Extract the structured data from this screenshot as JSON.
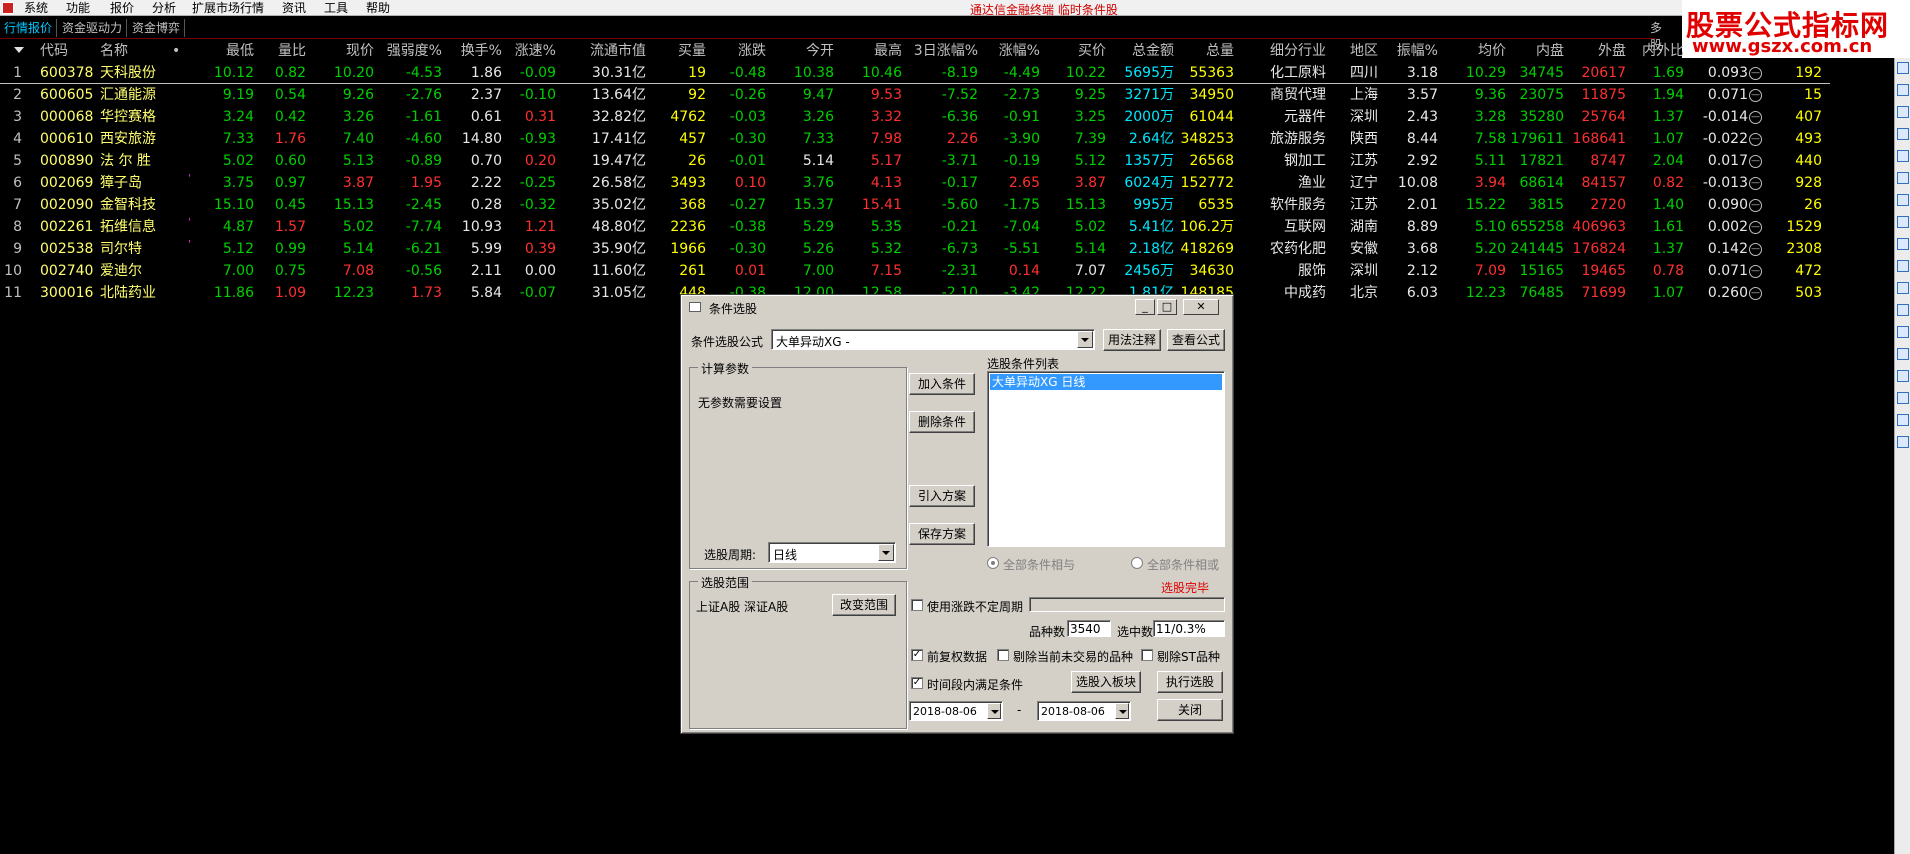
{
  "menu": {
    "items": [
      "系统",
      "功能",
      "报价",
      "分析",
      "扩展市场行情",
      "资讯",
      "工具",
      "帮助"
    ],
    "title": "通达信金融终端 临时条件股"
  },
  "tabs": [
    "行情报价",
    "资金驱动力",
    "资金博弈"
  ],
  "tabs_more": "多股",
  "watermark": {
    "line1": "股票公式指标网",
    "line2": "www.gszx.com.cn"
  },
  "table": {
    "headers": [
      "代码",
      "名称",
      "•",
      "最低",
      "量比",
      "现价",
      "强弱度%",
      "换手%",
      "涨速%",
      "流通市值",
      "买量",
      "涨跌",
      "今开",
      "最高",
      "3日涨幅%",
      "涨幅%",
      "买价",
      "总金额",
      "总量",
      "细分行业",
      "地区",
      "振幅%",
      "均价",
      "内盘",
      "外盘",
      "内外比"
    ],
    "rows": [
      {
        "no": "1",
        "code": "600378",
        "name": "天科股份",
        "flag": "",
        "low": "10.12",
        "vr": "0.82",
        "price": "10.20",
        "str": "-4.53",
        "turn": "1.86",
        "spd": "-0.09",
        "mcap": "30.31亿",
        "bq": "19",
        "chg": "-0.48",
        "open": "10.38",
        "high": "10.46",
        "r3": "-8.19",
        "pct": "-4.49",
        "bp": "10.22",
        "amt": "5695万",
        "vol": "55363",
        "ind": "化工原料",
        "area": "四川",
        "amp": "3.18",
        "avg": "10.29",
        "inv": "34745",
        "outv": "20617",
        "ratio": "1.69",
        "x1": "0.093",
        "x2": "192"
      },
      {
        "no": "2",
        "code": "600605",
        "name": "汇通能源",
        "flag": "",
        "low": "9.19",
        "vr": "0.54",
        "price": "9.26",
        "str": "-2.76",
        "turn": "2.37",
        "spd": "-0.10",
        "mcap": "13.64亿",
        "bq": "92",
        "chg": "-0.26",
        "open": "9.47",
        "high": "9.53",
        "r3": "-7.52",
        "pct": "-2.73",
        "bp": "9.25",
        "amt": "3271万",
        "vol": "34950",
        "ind": "商贸代理",
        "area": "上海",
        "amp": "3.57",
        "avg": "9.36",
        "inv": "23075",
        "outv": "11875",
        "ratio": "1.94",
        "x1": "0.071",
        "x2": "15"
      },
      {
        "no": "3",
        "code": "000068",
        "name": "华控赛格",
        "flag": "",
        "low": "3.24",
        "vr": "0.42",
        "price": "3.26",
        "str": "-1.61",
        "turn": "0.61",
        "spd": "0.31",
        "mcap": "32.82亿",
        "bq": "4762",
        "chg": "-0.03",
        "open": "3.26",
        "high": "3.32",
        "r3": "-6.36",
        "pct": "-0.91",
        "bp": "3.25",
        "amt": "2000万",
        "vol": "61044",
        "ind": "元器件",
        "area": "深圳",
        "amp": "2.43",
        "avg": "3.28",
        "inv": "35280",
        "outv": "25764",
        "ratio": "1.37",
        "x1": "-0.014",
        "x2": "407"
      },
      {
        "no": "4",
        "code": "000610",
        "name": "西安旅游",
        "flag": "",
        "low": "7.33",
        "vr": "1.76",
        "price": "7.40",
        "str": "-4.60",
        "turn": "14.80",
        "spd": "-0.93",
        "mcap": "17.41亿",
        "bq": "457",
        "chg": "-0.30",
        "open": "7.33",
        "high": "7.98",
        "r3": "2.26",
        "pct": "-3.90",
        "bp": "7.39",
        "amt": "2.64亿",
        "vol": "348253",
        "ind": "旅游服务",
        "area": "陕西",
        "amp": "8.44",
        "avg": "7.58",
        "inv": "179611",
        "outv": "168641",
        "ratio": "1.07",
        "x1": "-0.022",
        "x2": "493"
      },
      {
        "no": "5",
        "code": "000890",
        "name": "法 尔 胜",
        "flag": "",
        "low": "5.02",
        "vr": "0.60",
        "price": "5.13",
        "str": "-0.89",
        "turn": "0.70",
        "spd": "0.20",
        "mcap": "19.47亿",
        "bq": "26",
        "chg": "-0.01",
        "open": "5.14",
        "high": "5.17",
        "r3": "-3.71",
        "pct": "-0.19",
        "bp": "5.12",
        "amt": "1357万",
        "vol": "26568",
        "ind": "钢加工",
        "area": "江苏",
        "amp": "2.92",
        "avg": "5.11",
        "inv": "17821",
        "outv": "8747",
        "ratio": "2.04",
        "x1": "0.017",
        "x2": "440"
      },
      {
        "no": "6",
        "code": "002069",
        "name": "獐子岛",
        "flag": "'",
        "low": "3.75",
        "vr": "0.97",
        "price": "3.87",
        "str": "1.95",
        "turn": "2.22",
        "spd": "-0.25",
        "mcap": "26.58亿",
        "bq": "3493",
        "chg": "0.10",
        "open": "3.76",
        "high": "4.13",
        "r3": "-0.17",
        "pct": "2.65",
        "bp": "3.87",
        "amt": "6024万",
        "vol": "152772",
        "ind": "渔业",
        "area": "辽宁",
        "amp": "10.08",
        "avg": "3.94",
        "inv": "68614",
        "outv": "84157",
        "ratio": "0.82",
        "x1": "-0.013",
        "x2": "928"
      },
      {
        "no": "7",
        "code": "002090",
        "name": "金智科技",
        "flag": "",
        "low": "15.10",
        "vr": "0.45",
        "price": "15.13",
        "str": "-2.45",
        "turn": "0.28",
        "spd": "-0.32",
        "mcap": "35.02亿",
        "bq": "368",
        "chg": "-0.27",
        "open": "15.37",
        "high": "15.41",
        "r3": "-5.60",
        "pct": "-1.75",
        "bp": "15.13",
        "amt": "995万",
        "vol": "6535",
        "ind": "软件服务",
        "area": "江苏",
        "amp": "2.01",
        "avg": "15.22",
        "inv": "3815",
        "outv": "2720",
        "ratio": "1.40",
        "x1": "0.090",
        "x2": "26"
      },
      {
        "no": "8",
        "code": "002261",
        "name": "拓维信息",
        "flag": "'",
        "low": "4.87",
        "vr": "1.57",
        "price": "5.02",
        "str": "-7.74",
        "turn": "10.93",
        "spd": "1.21",
        "mcap": "48.80亿",
        "bq": "2236",
        "chg": "-0.38",
        "open": "5.29",
        "high": "5.35",
        "r3": "-0.21",
        "pct": "-7.04",
        "bp": "5.02",
        "amt": "5.41亿",
        "vol": "106.2万",
        "ind": "互联网",
        "area": "湖南",
        "amp": "8.89",
        "avg": "5.10",
        "inv": "655258",
        "outv": "406963",
        "ratio": "1.61",
        "x1": "0.002",
        "x2": "1529"
      },
      {
        "no": "9",
        "code": "002538",
        "name": "司尔特",
        "flag": "'",
        "low": "5.12",
        "vr": "0.99",
        "price": "5.14",
        "str": "-6.21",
        "turn": "5.99",
        "spd": "0.39",
        "mcap": "35.90亿",
        "bq": "1966",
        "chg": "-0.30",
        "open": "5.26",
        "high": "5.32",
        "r3": "-6.73",
        "pct": "-5.51",
        "bp": "5.14",
        "amt": "2.18亿",
        "vol": "418269",
        "ind": "农药化肥",
        "area": "安徽",
        "amp": "3.68",
        "avg": "5.20",
        "inv": "241445",
        "outv": "176824",
        "ratio": "1.37",
        "x1": "0.142",
        "x2": "2308"
      },
      {
        "no": "10",
        "code": "002740",
        "name": "爱迪尔",
        "flag": "",
        "low": "7.00",
        "vr": "0.75",
        "price": "7.08",
        "str": "-0.56",
        "turn": "2.11",
        "spd": "0.00",
        "mcap": "11.60亿",
        "bq": "261",
        "chg": "0.01",
        "open": "7.00",
        "high": "7.15",
        "r3": "-2.31",
        "pct": "0.14",
        "bp": "7.07",
        "amt": "2456万",
        "vol": "34630",
        "ind": "服饰",
        "area": "深圳",
        "amp": "2.12",
        "avg": "7.09",
        "inv": "15165",
        "outv": "19465",
        "ratio": "0.78",
        "x1": "0.071",
        "x2": "472"
      },
      {
        "no": "11",
        "code": "300016",
        "name": "北陆药业",
        "flag": "",
        "low": "11.86",
        "vr": "1.09",
        "price": "12.23",
        "str": "1.73",
        "turn": "5.84",
        "spd": "-0.07",
        "mcap": "31.05亿",
        "bq": "448",
        "chg": "-0.38",
        "open": "12.00",
        "high": "12.58",
        "r3": "-2.10",
        "pct": "-3.42",
        "bp": "12.22",
        "amt": "1.81亿",
        "vol": "148185",
        "ind": "中成药",
        "area": "北京",
        "amp": "6.03",
        "avg": "12.23",
        "inv": "76485",
        "outv": "71699",
        "ratio": "1.07",
        "x1": "0.260",
        "x2": "503"
      }
    ]
  },
  "dialog": {
    "title": "条件选股",
    "formula_label": "条件选股公式",
    "formula_value": "大单异动XG   -",
    "btn_usage": "用法注释",
    "btn_view": "查看公式",
    "params_group": "计算参数",
    "params_text": "无参数需要设置",
    "btn_add": "加入条件",
    "btn_delete": "删除条件",
    "btn_import": "引入方案",
    "btn_save": "保存方案",
    "list_label": "选股条件列表",
    "list_items": [
      "大单异动XG  日线"
    ],
    "radio_and": "全部条件相与",
    "radio_or": "全部条件相或",
    "period_label": "选股周期:",
    "period_value": "日线",
    "status": "选股完毕",
    "range_group": "选股范围",
    "range_text": "上证A股  深证A股",
    "btn_range": "改变范围",
    "chk_period": "使用涨跌不定周期",
    "count_label": "品种数",
    "count_value": "3540",
    "selected_label": "选中数",
    "selected_value": "11/0.3%",
    "chk_fq": "前复权数据",
    "chk_untraded": "剔除当前未交易的品种",
    "chk_st": "剔除ST品种",
    "chk_time": "时间段内满足条件",
    "btn_block": "选股入板块",
    "btn_exec": "执行选股",
    "date_from": "2018-08-06",
    "date_sep": "-",
    "date_to": "2018-08-06",
    "btn_close": "关闭",
    "check_mark": "✓"
  }
}
